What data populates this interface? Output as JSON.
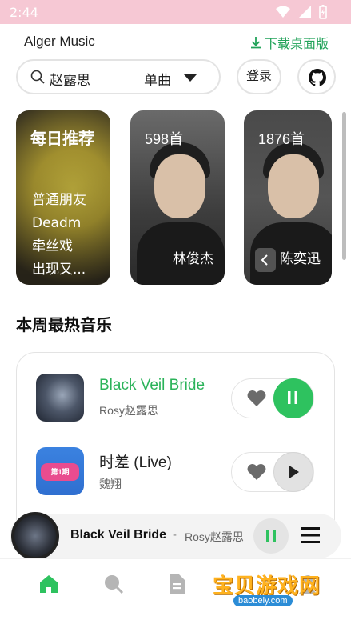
{
  "status_bar": {
    "time": "2:44"
  },
  "header": {
    "app_title": "Alger Music",
    "download_label": "下载桌面版"
  },
  "search": {
    "value": "赵露思",
    "type_label": "单曲"
  },
  "actions": {
    "login_label": "登录"
  },
  "daily": {
    "title": "每日推荐",
    "songs": [
      "普通朋友",
      "Deadm",
      "牵丝戏",
      "出现又..."
    ]
  },
  "artists": [
    {
      "count": "598首",
      "name": "林俊杰"
    },
    {
      "count": "1876首",
      "name": "陈奕迅"
    }
  ],
  "hot_section": {
    "title": "本周最热音乐",
    "songs": [
      {
        "name": "Black Veil Bride",
        "artist": "Rosy赵露思",
        "state": "playing"
      },
      {
        "name": "时差 (Live)",
        "artist": "魏翔",
        "state": "paused",
        "cover_badge": "第1期"
      }
    ]
  },
  "now_playing": {
    "title": "Black Veil Bride",
    "separator": "-",
    "artist": "Rosy赵露思"
  },
  "watermark": {
    "text": "宝贝游戏网",
    "url": "baobeiy.com"
  },
  "colors": {
    "accent": "#2ec25f",
    "status_bar": "#f6c8d4"
  }
}
